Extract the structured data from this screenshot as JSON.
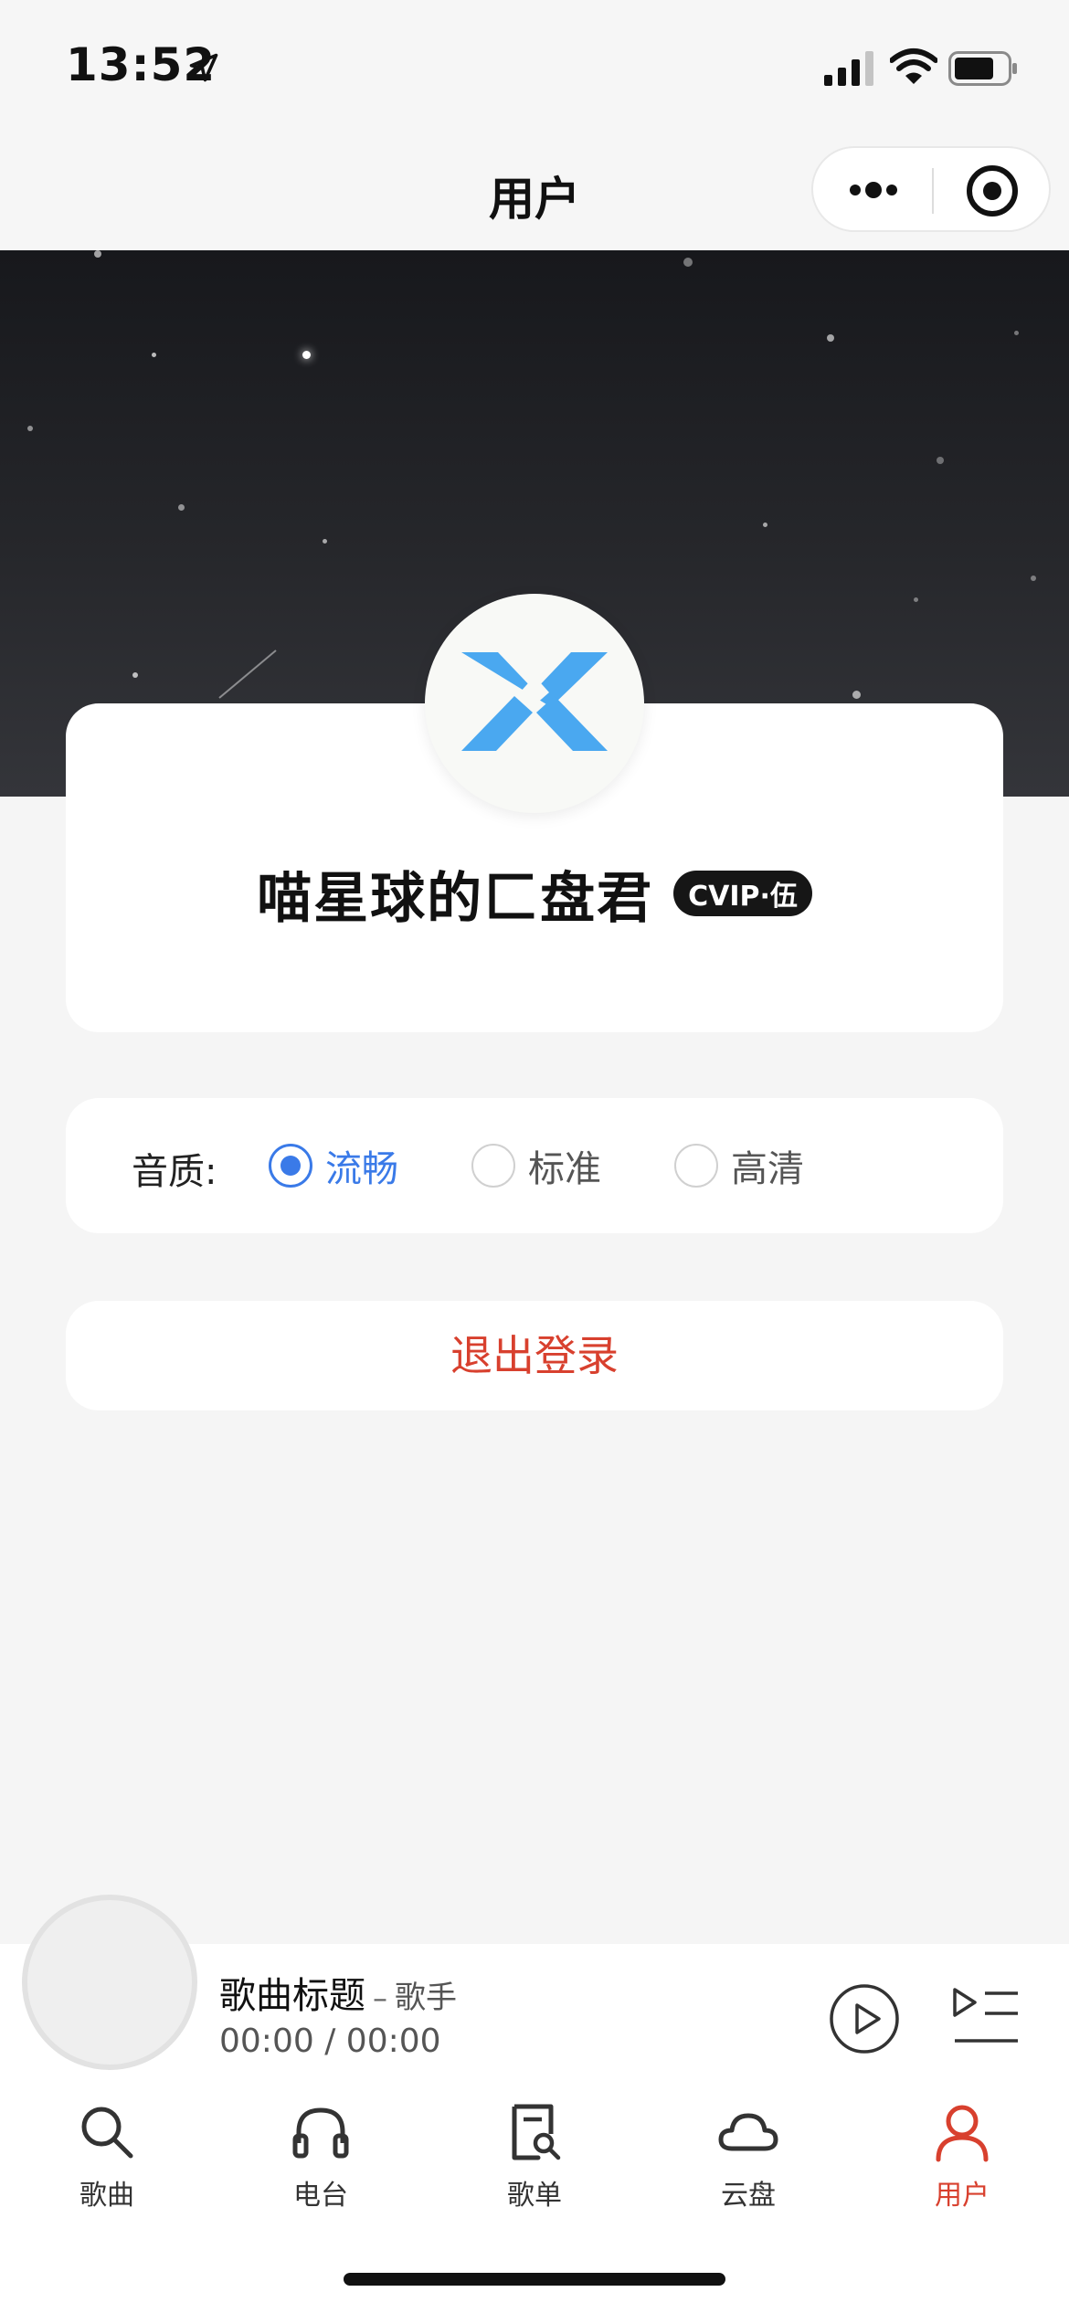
{
  "status_bar": {
    "time": "13:52",
    "icons": [
      "location-arrow-icon",
      "signal-icon",
      "wifi-icon",
      "battery-icon"
    ]
  },
  "nav": {
    "title": "用户",
    "capsule": [
      "more-icon",
      "close-circle-icon"
    ]
  },
  "profile": {
    "username": "喵星球的匚盘君",
    "vip_badge": "CVIP·伍",
    "avatar_icon": "logo-icon"
  },
  "quality": {
    "label": "音质:",
    "options": [
      {
        "label": "流畅",
        "selected": true
      },
      {
        "label": "标准",
        "selected": false
      },
      {
        "label": "高清",
        "selected": false
      }
    ]
  },
  "logout_label": "退出登录",
  "player": {
    "title": "歌曲标题",
    "separator": "–",
    "artist": "歌手",
    "current_time": "00:00",
    "time_separator": "/",
    "total_time": "00:00"
  },
  "tabs": [
    {
      "label": "歌曲",
      "icon": "search-icon",
      "active": false
    },
    {
      "label": "电台",
      "icon": "headphones-icon",
      "active": false
    },
    {
      "label": "歌单",
      "icon": "playlist-doc-icon",
      "active": false
    },
    {
      "label": "云盘",
      "icon": "cloud-icon",
      "active": false
    },
    {
      "label": "用户",
      "icon": "user-icon",
      "active": true
    }
  ],
  "colors": {
    "accent_red": "#d8402e",
    "accent_blue": "#3a7ae8",
    "logo_blue": "#4aa8f0"
  }
}
